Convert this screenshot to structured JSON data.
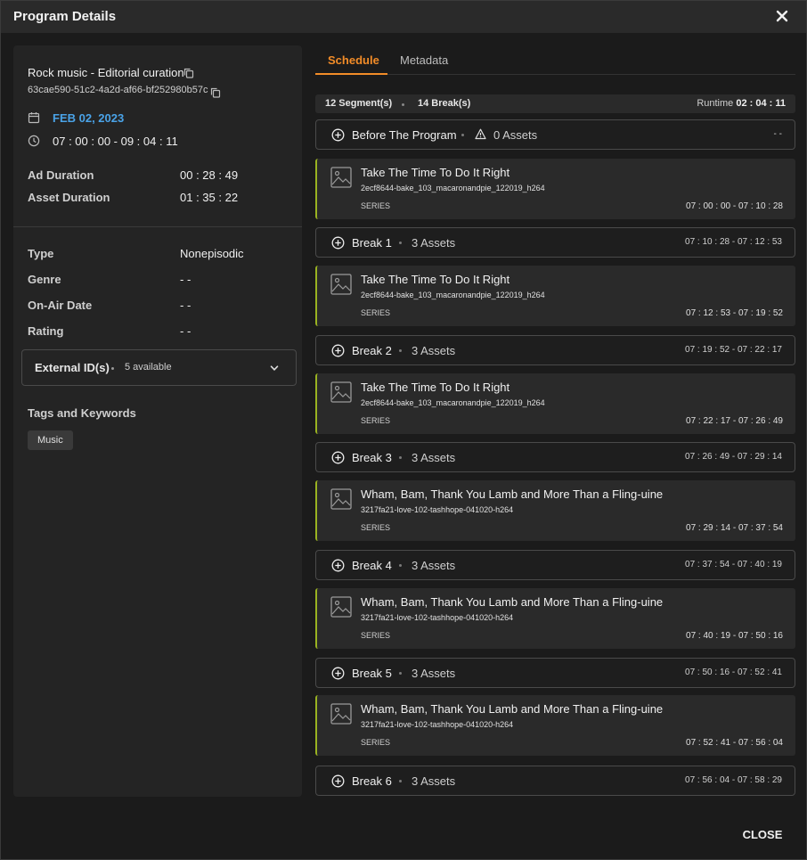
{
  "dialog": {
    "title": "Program Details",
    "close_label": "CLOSE"
  },
  "program": {
    "name": "Rock music - Editorial curation",
    "id": "63cae590-51c2-4a2d-af66-bf252980b57c",
    "date": "FEB 02, 2023",
    "time_range": "07 : 00 : 00 - 09 : 04 : 11",
    "details": [
      {
        "label": "Ad Duration",
        "value": "00 : 28 : 49"
      },
      {
        "label": "Asset Duration",
        "value": "01 : 35 : 22"
      }
    ],
    "attributes": [
      {
        "label": "Type",
        "value": "Nonepisodic"
      },
      {
        "label": "Genre",
        "value": "- -"
      },
      {
        "label": "On-Air Date",
        "value": "- -"
      },
      {
        "label": "Rating",
        "value": "- -"
      }
    ],
    "external_ids": {
      "label": "External ID(s)",
      "count_text": "5 available"
    },
    "tags": {
      "title": "Tags and Keywords",
      "items": [
        "Music"
      ]
    }
  },
  "tabs": [
    {
      "label": "Schedule",
      "active": true
    },
    {
      "label": "Metadata",
      "active": false
    }
  ],
  "summary": {
    "segments": "12 Segment(s)",
    "breaks": "14 Break(s)",
    "runtime_label": "Runtime",
    "runtime_value": "02 : 04 : 11"
  },
  "schedule": [
    {
      "kind": "break",
      "name": "Before The Program",
      "assets": "0 Assets",
      "warning": true,
      "time": "- -"
    },
    {
      "kind": "segment",
      "title": "Take The Time To Do It Right",
      "file": "2ecf8644-bake_103_macaronandpie_122019_h264",
      "type": "SERIES",
      "time": "07 : 00 : 00 - 07 : 10 : 28"
    },
    {
      "kind": "break",
      "name": "Break 1",
      "assets": "3 Assets",
      "warning": false,
      "time": "07 : 10 : 28 - 07 : 12 : 53"
    },
    {
      "kind": "segment",
      "title": "Take The Time To Do It Right",
      "file": "2ecf8644-bake_103_macaronandpie_122019_h264",
      "type": "SERIES",
      "time": "07 : 12 : 53 - 07 : 19 : 52"
    },
    {
      "kind": "break",
      "name": "Break 2",
      "assets": "3 Assets",
      "warning": false,
      "time": "07 : 19 : 52 - 07 : 22 : 17"
    },
    {
      "kind": "segment",
      "title": "Take The Time To Do It Right",
      "file": "2ecf8644-bake_103_macaronandpie_122019_h264",
      "type": "SERIES",
      "time": "07 : 22 : 17 - 07 : 26 : 49"
    },
    {
      "kind": "break",
      "name": "Break 3",
      "assets": "3 Assets",
      "warning": false,
      "time": "07 : 26 : 49 - 07 : 29 : 14"
    },
    {
      "kind": "segment",
      "title": "Wham, Bam, Thank You Lamb and More Than a Fling-uine",
      "file": "3217fa21-love-102-tashhope-041020-h264",
      "type": "SERIES",
      "time": "07 : 29 : 14 - 07 : 37 : 54"
    },
    {
      "kind": "break",
      "name": "Break 4",
      "assets": "3 Assets",
      "warning": false,
      "time": "07 : 37 : 54 - 07 : 40 : 19"
    },
    {
      "kind": "segment",
      "title": "Wham, Bam, Thank You Lamb and More Than a Fling-uine",
      "file": "3217fa21-love-102-tashhope-041020-h264",
      "type": "SERIES",
      "time": "07 : 40 : 19 - 07 : 50 : 16"
    },
    {
      "kind": "break",
      "name": "Break 5",
      "assets": "3 Assets",
      "warning": false,
      "time": "07 : 50 : 16 - 07 : 52 : 41"
    },
    {
      "kind": "segment",
      "title": "Wham, Bam, Thank You Lamb and More Than a Fling-uine",
      "file": "3217fa21-love-102-tashhope-041020-h264",
      "type": "SERIES",
      "time": "07 : 52 : 41 - 07 : 56 : 04"
    },
    {
      "kind": "break",
      "name": "Break 6",
      "assets": "3 Assets",
      "warning": false,
      "time": "07 : 56 : 04 - 07 : 58 : 29"
    }
  ],
  "colors": {
    "accent": "#f28c28",
    "date": "#4aa3e8",
    "segment_marker": "#9ab321"
  },
  "icons": [
    "close-icon",
    "copy-icon",
    "calendar-icon",
    "clock-icon",
    "chevron-down-icon",
    "plus-circle-icon",
    "warning-icon",
    "image-placeholder-icon"
  ]
}
